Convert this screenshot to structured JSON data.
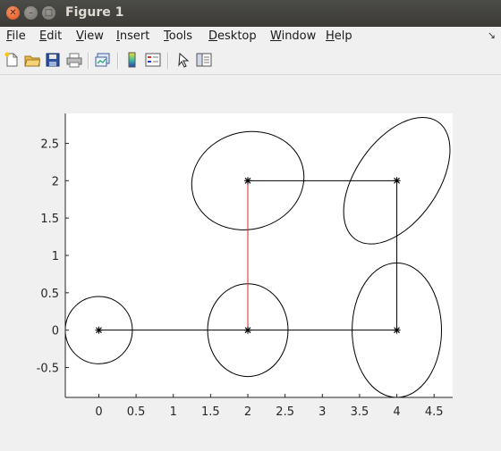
{
  "window": {
    "title": "Figure 1",
    "close_glyph": "✕",
    "min_glyph": "–",
    "max_glyph": "□"
  },
  "menu": {
    "items": [
      {
        "mnemonic": "F",
        "rest": "ile"
      },
      {
        "mnemonic": "E",
        "rest": "dit"
      },
      {
        "mnemonic": "V",
        "rest": "iew"
      },
      {
        "mnemonic": "I",
        "rest": "nsert"
      },
      {
        "mnemonic": "T",
        "rest": "ools"
      },
      {
        "mnemonic": "D",
        "rest": "esktop"
      },
      {
        "mnemonic": "W",
        "rest": "indow"
      },
      {
        "mnemonic": "H",
        "rest": "elp"
      }
    ],
    "arrow_glyph": "↘"
  },
  "toolbar": {
    "icons": [
      "new-figure-icon",
      "open-folder-icon",
      "save-icon",
      "print-icon",
      "link-plot-icon",
      "colorbar-icon",
      "legend-icon",
      "pointer-icon",
      "property-editor-icon"
    ]
  },
  "chart_data": {
    "type": "line",
    "title": "",
    "xlabel": "",
    "ylabel": "",
    "xlim": [
      -0.45,
      4.75
    ],
    "ylim": [
      -0.9,
      2.9
    ],
    "xticks": [
      0,
      0.5,
      1,
      1.5,
      2,
      2.5,
      3,
      3.5,
      4,
      4.5
    ],
    "xtick_labels": [
      "0",
      "0.5",
      "1",
      "1.5",
      "2",
      "2.5",
      "3",
      "3.5",
      "4",
      "4.5"
    ],
    "yticks": [
      -0.5,
      0,
      0.5,
      1,
      1.5,
      2,
      2.5
    ],
    "ytick_labels": [
      "-0.5",
      "0",
      "0.5",
      "1",
      "1.5",
      "2",
      "2.5"
    ],
    "grid": false,
    "nodes": [
      {
        "x": 0,
        "y": 0
      },
      {
        "x": 2,
        "y": 0
      },
      {
        "x": 4,
        "y": 0
      },
      {
        "x": 2,
        "y": 2
      },
      {
        "x": 4,
        "y": 2
      }
    ],
    "edges": [
      {
        "from": 0,
        "to": 1,
        "color": "#000000"
      },
      {
        "from": 1,
        "to": 2,
        "color": "#000000"
      },
      {
        "from": 2,
        "to": 4,
        "color": "#000000"
      },
      {
        "from": 3,
        "to": 4,
        "color": "#000000"
      },
      {
        "from": 1,
        "to": 3,
        "color": "#d62728"
      }
    ],
    "ellipses": [
      {
        "cx": 0,
        "cy": 0,
        "rx": 0.45,
        "ry": 0.45,
        "angle": 0
      },
      {
        "cx": 2,
        "cy": 0,
        "rx": 0.54,
        "ry": 0.62,
        "angle": 0
      },
      {
        "cx": 4,
        "cy": 0,
        "rx": 0.6,
        "ry": 0.9,
        "angle": 0
      },
      {
        "cx": 2,
        "cy": 2,
        "rx": 0.76,
        "ry": 0.65,
        "angle": -15
      },
      {
        "cx": 4,
        "cy": 2,
        "rx": 0.55,
        "ry": 0.96,
        "angle": 35
      }
    ]
  }
}
